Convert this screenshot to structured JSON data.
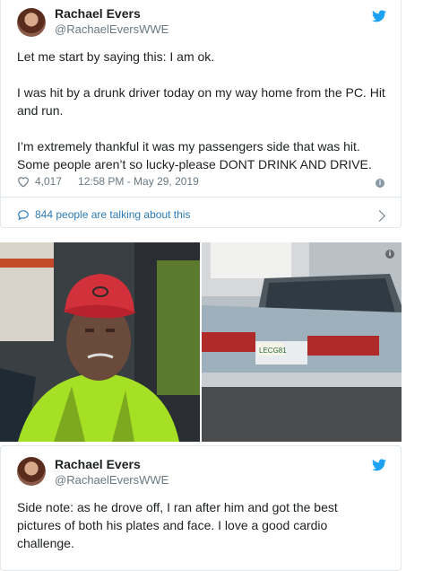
{
  "tweet1": {
    "name": "Rachael Evers",
    "handle": "@RachaelEversWWE",
    "paragraphs": [
      "Let me start by saying this: I am ok.",
      "I was hit by a drunk driver today on my way home from the PC. Hit and run.",
      "I’m extremely thankful it was my passengers side that was hit. Some people aren’t so lucky-please DONT DRINK AND DRIVE."
    ],
    "likes": "4,017",
    "timestamp": "12:58 PM - May 29, 2019",
    "talking": "844 people are talking about this"
  },
  "photos": {
    "plate_text": "LECG81"
  },
  "tweet2": {
    "name": "Rachael Evers",
    "handle": "@RachaelEversWWE",
    "text": "Side note: as he drove off, I ran after him and got the best pictures of both his plates and face. I love a good cardio challenge."
  },
  "colors": {
    "link": "#2b7bb9",
    "bird": "#1da1f2",
    "muted": "#697882"
  }
}
